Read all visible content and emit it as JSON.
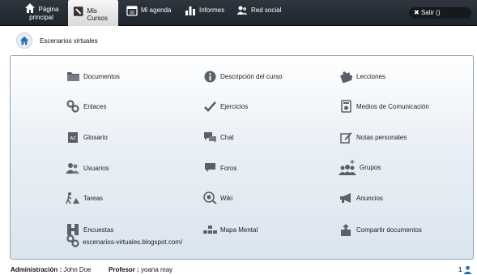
{
  "topnav": {
    "home_label_1": "Página",
    "home_label_2": "principal",
    "cursos_label": "Mis Cursos",
    "agenda_label": "Mi agenda",
    "informes_label": "Informes",
    "social_label": "Red social",
    "logout_label": "Salir ()"
  },
  "breadcrumb": {
    "course": "Escenarios virtuales"
  },
  "tools": [
    {
      "label": "Documentos",
      "icon": "folder-icon"
    },
    {
      "label": "Descripción del curso",
      "icon": "info-icon"
    },
    {
      "label": "Lecciones",
      "icon": "puzzle-icon"
    },
    {
      "label": "Enlaces",
      "icon": "link-icon"
    },
    {
      "label": "Ejercicios",
      "icon": "checkmark-icon"
    },
    {
      "label": "Medios de Comunicación",
      "icon": "media-icon"
    },
    {
      "label": "Glosario",
      "icon": "glossary-icon"
    },
    {
      "label": "Chat",
      "icon": "chat-icon"
    },
    {
      "label": "Notas personales",
      "icon": "notes-icon"
    },
    {
      "label": "Usuarios",
      "icon": "users-icon"
    },
    {
      "label": "Foros",
      "icon": "forum-icon"
    },
    {
      "label": "Grupos",
      "icon": "groups-icon"
    },
    {
      "label": "Tareas",
      "icon": "tasks-icon"
    },
    {
      "label": "Wiki",
      "icon": "wiki-icon"
    },
    {
      "label": "Anuncios",
      "icon": "megaphone-icon"
    },
    {
      "label": "Encuestas",
      "icon": "survey-icon"
    },
    {
      "label": "Mapa Mental",
      "icon": "mindmap-icon"
    },
    {
      "label": "Compartir documentos",
      "icon": "share-icon"
    }
  ],
  "extra_link": {
    "label": "escenarios-virtuales.blogspot.com/",
    "icon": "link-icon"
  },
  "footer": {
    "admin_label": "Administración :",
    "admin_name": "John Doe",
    "prof_label": "Profesor :",
    "prof_name": "yoana may",
    "online_count": "1"
  },
  "colors": {
    "topbar": "#2a3038",
    "panel_border": "#8fa6bd",
    "icon_gray": "#5a5f66",
    "accent_blue": "#1b6fb3"
  }
}
